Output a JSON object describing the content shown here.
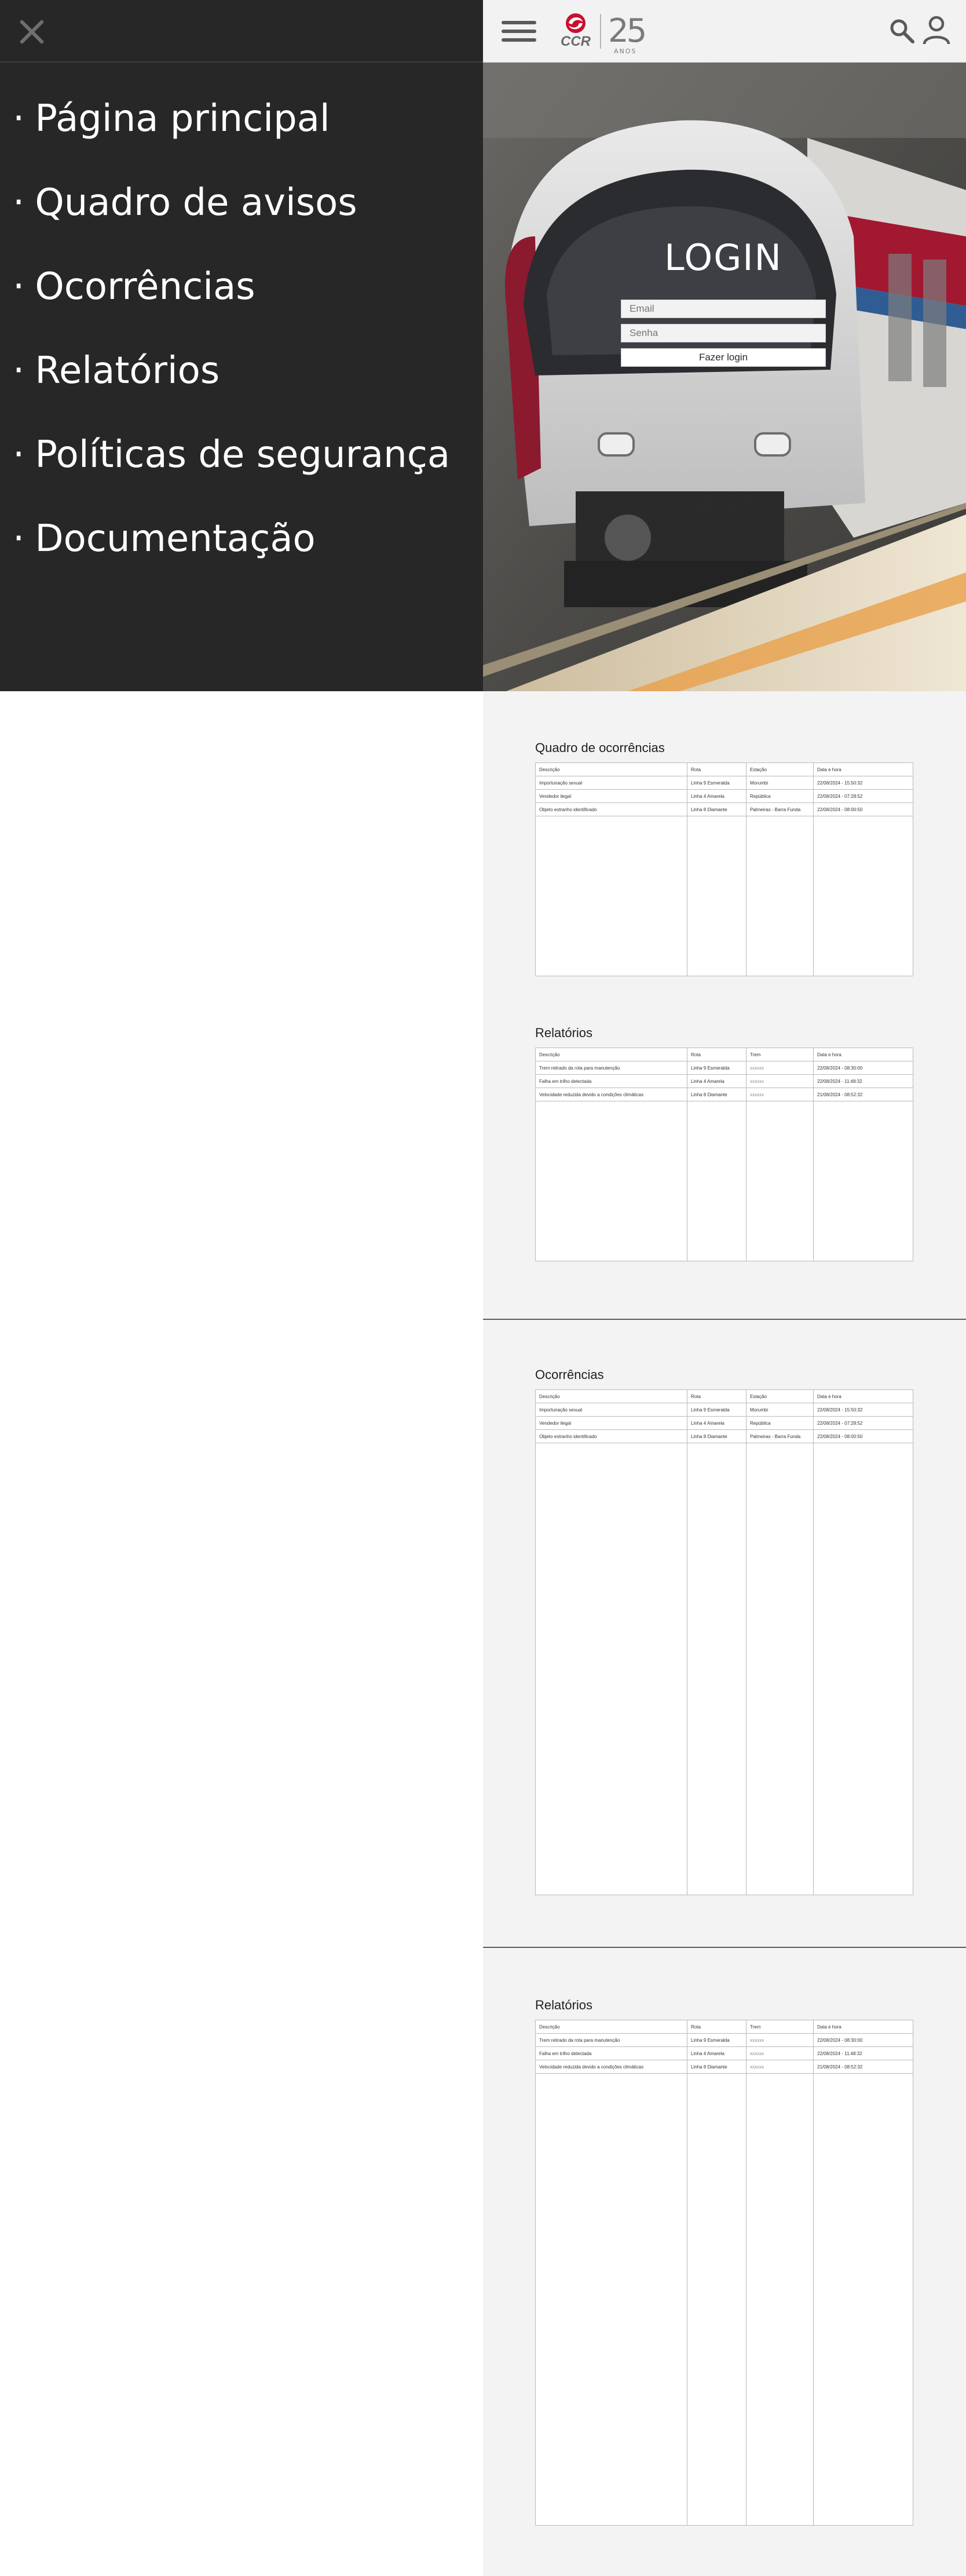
{
  "menu": {
    "items": [
      {
        "label": "Página principal"
      },
      {
        "label": "Quadro de avisos"
      },
      {
        "label": "Ocorrências"
      },
      {
        "label": "Relatórios"
      },
      {
        "label": "Políticas de segurança"
      },
      {
        "label": "Documentação"
      }
    ],
    "bullet": "·"
  },
  "header": {
    "logo_text": "CCR",
    "anniversary_number": "25",
    "anniversary_word": "ANOS"
  },
  "hero": {
    "train_id": "A-05"
  },
  "login": {
    "title": "LOGIN",
    "email_placeholder": "Email",
    "password_placeholder": "Senha",
    "button_label": "Fazer login"
  },
  "panels": [
    {
      "title": "Quadro de ocorrências",
      "columns": [
        "Descrição",
        "Rota",
        "Estação",
        "Data e hora"
      ],
      "rows": [
        [
          "Importunação sexual",
          "Linha 9 Esmeralda",
          "Morumbi",
          "22/08/2024 - 15:50:32"
        ],
        [
          "Vendedor ilegal",
          "Linha 4 Amarela",
          "República",
          "22/08/2024 - 07:28:52"
        ],
        [
          "Objeto estranho identificado",
          "Linha 8 Diamante",
          "Palmeiras - Barra Funda",
          "22/08/2024 - 08:00:50"
        ]
      ]
    },
    {
      "title": "Relatórios",
      "columns": [
        "Descrição",
        "Rota",
        "Trem",
        "Data e hora"
      ],
      "rows": [
        [
          "Trem retirado da rota para manutenção",
          "Linha 9 Esmeralda",
          "xxxxxx",
          "22/08/2024 - 08:30:00"
        ],
        [
          "Falha em trilho detectada",
          "Linha 4 Amarela",
          "xxxxxx",
          "22/08/2024 - 11:48:32"
        ],
        [
          "Velocidade reduzida devido a condições climáticas",
          "Linha 8 Diamante",
          "xxxxxx",
          "21/08/2024 - 08:52:32"
        ]
      ]
    },
    {
      "title": "Ocorrências",
      "columns": [
        "Descrição",
        "Rota",
        "Estação",
        "Data e hora"
      ],
      "rows": [
        [
          "Importunação sexual",
          "Linha 9 Esmeralda",
          "Morumbi",
          "22/08/2024 - 15:50:32"
        ],
        [
          "Vendedor ilegal",
          "Linha 4 Amarela",
          "República",
          "22/08/2024 - 07:28:52"
        ],
        [
          "Objeto estranho identificado",
          "Linha 8 Diamante",
          "Palmeiras - Barra Funda",
          "22/08/2024 - 08:00:50"
        ]
      ]
    },
    {
      "title": "Relatórios",
      "columns": [
        "Descrição",
        "Rota",
        "Trem",
        "Data e hora"
      ],
      "rows": [
        [
          "Trem retirado da rota para manutenção",
          "Linha 9 Esmeralda",
          "xxxxxx",
          "22/08/2024 - 08:30:00"
        ],
        [
          "Falha em trilho detectada",
          "Linha 4 Amarela",
          "xxxxxx",
          "22/08/2024 - 11:48:32"
        ],
        [
          "Velocidade reduzida devido a condições climáticas",
          "Linha 8 Diamante",
          "xxxxxx",
          "21/08/2024 - 08:52:32"
        ]
      ]
    }
  ],
  "colors": {
    "drawer_bg": "#272727",
    "page_bg": "#f3f3f3",
    "brand_red": "#c8102e"
  }
}
